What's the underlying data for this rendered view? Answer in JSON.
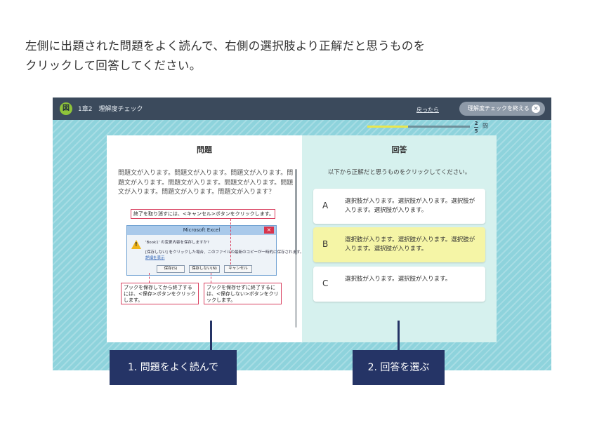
{
  "intro": {
    "line1": "左側に出題された問題をよく読んで、右側の選択肢より正解だと思うものを",
    "line2": "クリックして回答してください。"
  },
  "app": {
    "logo_char": "図",
    "chapter": "1章2　理解度チェック",
    "back_link": "戻ったら",
    "end_button": "理解度チェックを終える",
    "end_icon": "close-icon",
    "progress": {
      "current": "2",
      "total": "5",
      "unit": "問",
      "fraction": 0.4
    }
  },
  "question": {
    "title": "問題",
    "text": "問題文が入ります。問題文が入ります。問題文が入ります。問題文が入ります。問題文が入ります。問題文が入ります。問題文が入ります。問題文が入ります。問題文が入ります？",
    "callout_top": "終了を取り消すには、<キャンセル>ボタンをクリックします。",
    "dialog": {
      "title": "Microsoft Excel",
      "message": "'Book1' の変更内容を保存しますか?",
      "detail": "[保存しない] をクリックした場合、このファイルの最新のコピーが一時的に保存されます。",
      "link": "詳細を表示",
      "buttons": [
        "保存(S)",
        "保存しない(N)",
        "キャンセル"
      ]
    },
    "callout_left": "ブックを保存してから終了するには、<保存>ボタンをクリックします。",
    "callout_right": "ブックを保存せずに終了するには、<保存しない>ボタンをクリックします。"
  },
  "answer": {
    "title": "回答",
    "instruction": "以下から正解だと思うものをクリックしてください。",
    "choices": [
      {
        "letter": "A",
        "text": "選択肢が入ります。選択肢が入ります。選択肢が入ります。選択肢が入ります。",
        "selected": false
      },
      {
        "letter": "B",
        "text": "選択肢が入ります。選択肢が入ります。選択肢が入ります。選択肢が入ります。",
        "selected": true
      },
      {
        "letter": "C",
        "text": "選択肢が入ります。選択肢が入ります。",
        "selected": false
      }
    ]
  },
  "labels": {
    "step1": "1. 問題をよく読んで",
    "step2": "2. 回答を選ぶ"
  },
  "colors": {
    "bar": "#3b4a5c",
    "bg": "#8ed3dc",
    "navy": "#253466",
    "selected": "#f5f5a6",
    "accent": "#8fc43a"
  }
}
